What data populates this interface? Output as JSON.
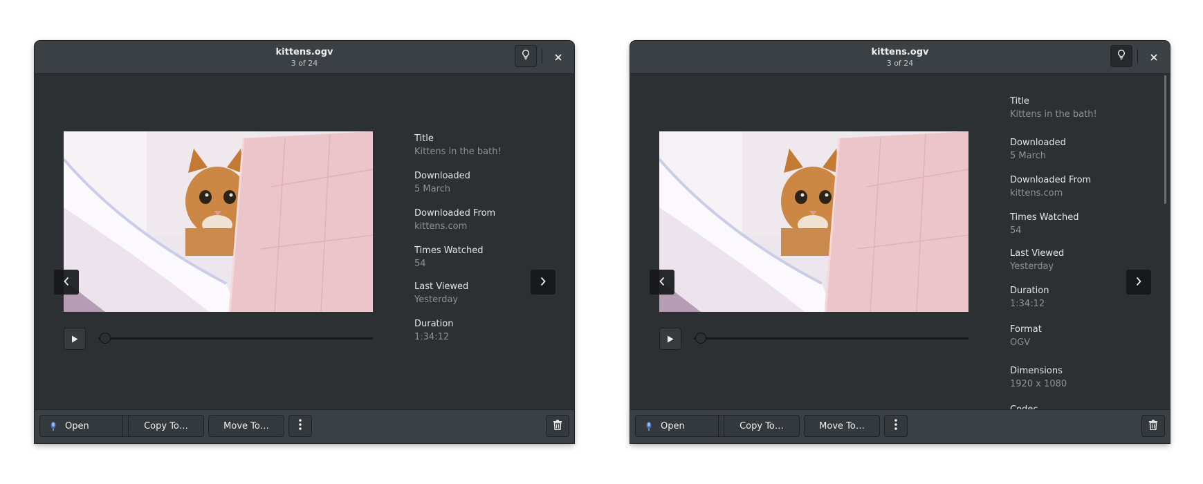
{
  "windows": [
    {
      "id": "left",
      "title": "kittens.ogv",
      "subtitle": "3 of 24",
      "hint_active": false,
      "properties": [
        {
          "label": "Title",
          "value": "Kittens in the bath!"
        },
        {
          "label": "Downloaded",
          "value": "5 March"
        },
        {
          "label": "Downloaded From",
          "value": "kittens.com"
        },
        {
          "label": "Times Watched",
          "value": "54"
        },
        {
          "label": "Last Viewed",
          "value": "Yesterday"
        },
        {
          "label": "Duration",
          "value": "1:34:12"
        }
      ],
      "toolbar": {
        "open": "Open",
        "copy": "Copy To…",
        "move": "Move To…"
      }
    },
    {
      "id": "right",
      "title": "kittens.ogv",
      "subtitle": "3 of 24",
      "hint_active": true,
      "properties": [
        {
          "label": "Title",
          "value": "Kittens in the bath!"
        },
        {
          "label": "Downloaded",
          "value": "5 March"
        },
        {
          "label": "Downloaded From",
          "value": "kittens.com"
        },
        {
          "label": "Times Watched",
          "value": "54"
        },
        {
          "label": "Last Viewed",
          "value": "Yesterday"
        },
        {
          "label": "Duration",
          "value": "1:34:12"
        },
        {
          "label": "Format",
          "value": "OGV"
        },
        {
          "label": "Dimensions",
          "value": "1920 x 1080"
        },
        {
          "label": "Codec",
          "value": ""
        }
      ],
      "toolbar": {
        "open": "Open",
        "copy": "Copy To…",
        "move": "Move To…"
      }
    }
  ],
  "playback": {
    "progress": 0
  },
  "icons": {
    "hint": "lightbulb-icon",
    "close": "close-icon",
    "prev": "chevron-left-icon",
    "next": "chevron-right-icon",
    "play": "play-icon",
    "open_app": "app-icon",
    "dropdown": "chevron-down-icon",
    "menu": "vertical-dots-icon",
    "trash": "trash-icon"
  },
  "colors": {
    "window_bg": "#2c3033",
    "header_bg": "#3a4043",
    "label": "#e6e6e4",
    "value": "#8c9193"
  }
}
